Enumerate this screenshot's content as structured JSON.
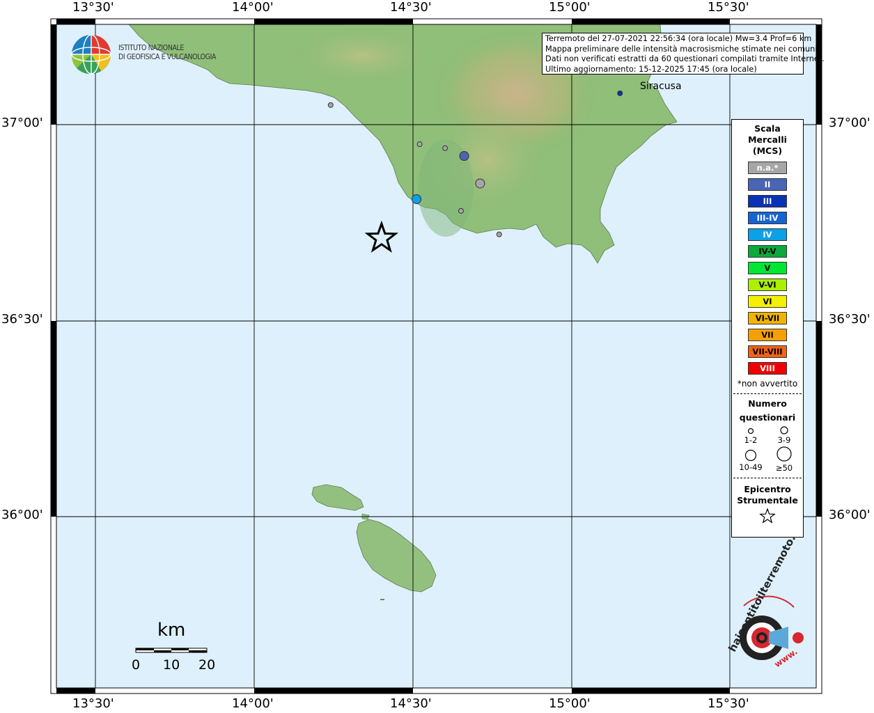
{
  "header": {
    "line1": "Terremoto del 27-07-2021 22:56:34 (ora locale) Mw=3.4 Prof=6 km",
    "line2": "Mappa preliminare delle intensità macrosismiche stimate nei comuni",
    "line3": "Dati non verificati estratti da 60 questionari compilati tramite Internet.",
    "line4": "Ultimo aggiornamento: 15-12-2025 17:45 (ora locale)"
  },
  "logo": {
    "line1": "ISTITUTO NAZIONALE",
    "line2": "DI GEOFISICA E VULCANOLOGIA",
    "icon": "ingv-globe-logo"
  },
  "axes": {
    "top": [
      "13°30'",
      "14°00'",
      "14°30'",
      "15°00'",
      "15°30'"
    ],
    "bottom": [
      "13°30'",
      "14°00'",
      "14°30'",
      "15°00'",
      "15°30'"
    ],
    "left": [
      "37°00'",
      "36°30'",
      "36°00'"
    ],
    "right": [
      "37°00'",
      "36°30'",
      "36°00'"
    ]
  },
  "places": {
    "siracusa": "Siracusa"
  },
  "legend": {
    "title1": "Scala",
    "title2": "Mercalli",
    "title3": "(MCS)",
    "classes": [
      {
        "label": "n.a.*",
        "color": "#a6a6a6"
      },
      {
        "label": "II",
        "color": "#4b64b4"
      },
      {
        "label": "III",
        "color": "#0a32b4"
      },
      {
        "label": "III-IV",
        "color": "#1464d2"
      },
      {
        "label": "IV",
        "color": "#0ca0e6"
      },
      {
        "label": "IV-V",
        "color": "#0aaa3c"
      },
      {
        "label": "V",
        "color": "#00e632"
      },
      {
        "label": "V-VI",
        "color": "#aaf000"
      },
      {
        "label": "VI",
        "color": "#f5f000"
      },
      {
        "label": "VI-VII",
        "color": "#f0b400"
      },
      {
        "label": "VII",
        "color": "#f5a000"
      },
      {
        "label": "VII-VIII",
        "color": "#f06414"
      },
      {
        "label": "VIII",
        "color": "#f00000"
      }
    ],
    "note": "*non avvertito",
    "count_title1": "Numero",
    "count_title2": "questionari",
    "counts": [
      "1-2",
      "3-9",
      "10-49",
      "≥50"
    ],
    "epicenter1": "Epicentro",
    "epicenter2": "Strumentale"
  },
  "scale_bar": {
    "unit": "km",
    "labels": [
      "0",
      "10",
      "20"
    ]
  },
  "site_logo": {
    "text1": "haisentitoilterremoto.it",
    "text2": "www.",
    "icon": "hai-sentito-il-terremoto-logo"
  },
  "observations": [
    {
      "lon": 14.24,
      "lat": 37.05,
      "mcs": "n.a.",
      "n": "1-2"
    },
    {
      "lon": 14.52,
      "lat": 36.95,
      "mcs": "n.a.",
      "n": "1-2"
    },
    {
      "lon": 14.6,
      "lat": 36.94,
      "mcs": "n.a.",
      "n": "1-2"
    },
    {
      "lon": 14.66,
      "lat": 36.92,
      "mcs": "II",
      "n": "3-9"
    },
    {
      "lon": 14.71,
      "lat": 36.85,
      "mcs": "n.a.",
      "n": "3-9"
    },
    {
      "lon": 14.51,
      "lat": 36.81,
      "mcs": "IV",
      "n": "3-9"
    },
    {
      "lon": 14.65,
      "lat": 36.78,
      "mcs": "n.a.",
      "n": "1-2"
    },
    {
      "lon": 14.77,
      "lat": 36.72,
      "mcs": "n.a.",
      "n": "1-2"
    },
    {
      "lon": 15.15,
      "lat": 37.08,
      "mcs": "III",
      "n": "1-2"
    }
  ],
  "epicenter": {
    "lon": 14.4,
    "lat": 36.71
  }
}
